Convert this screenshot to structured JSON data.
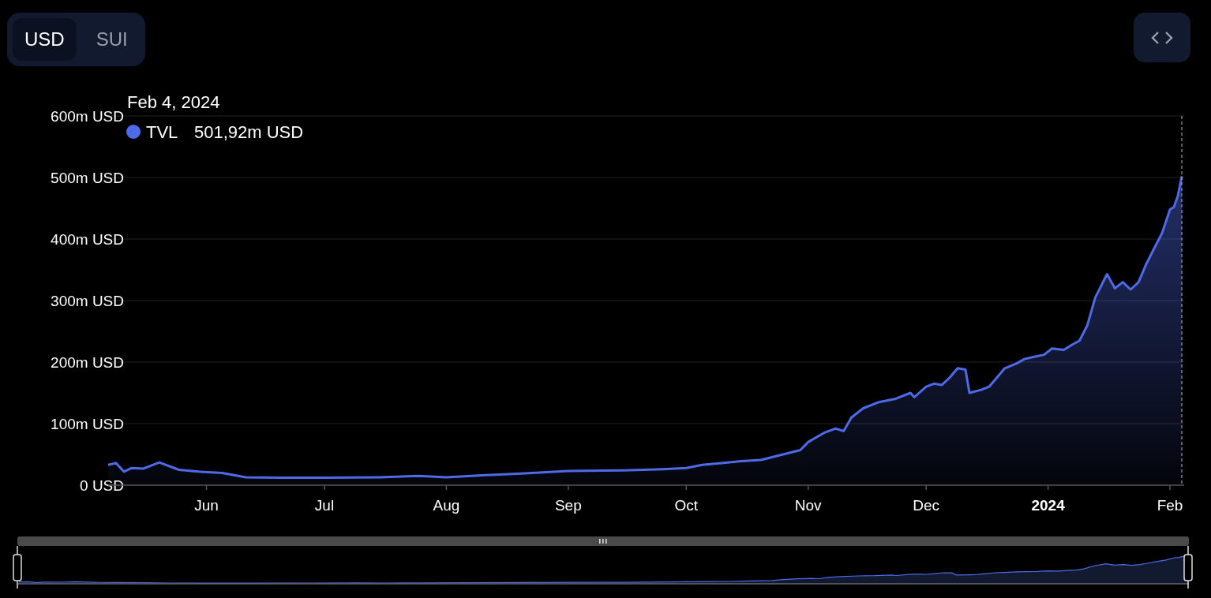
{
  "currency_toggle": [
    {
      "label": "USD",
      "selected": true
    },
    {
      "label": "SUI",
      "selected": false
    }
  ],
  "chart": {
    "tooltip": {
      "date": "Feb 4, 2024",
      "value": "501,92m USD"
    },
    "chart_data": {
      "type": "area",
      "grid": true,
      "xlim": [
        "2023-05-07",
        "2024-02-04"
      ],
      "ylim": [
        0,
        600
      ],
      "yticks": [
        {
          "value": 0,
          "label": "0 USD"
        },
        {
          "value": 100,
          "label": "100m USD"
        },
        {
          "value": 200,
          "label": "200m USD"
        },
        {
          "value": 300,
          "label": "300m USD"
        },
        {
          "value": 400,
          "label": "400m USD"
        },
        {
          "value": 500,
          "label": "500m USD"
        },
        {
          "value": 600,
          "label": "600m USD"
        }
      ],
      "xticks": [
        {
          "value": "2023-06-01",
          "label": "Jun"
        },
        {
          "value": "2023-07-01",
          "label": "Jul"
        },
        {
          "value": "2023-08-01",
          "label": "Aug"
        },
        {
          "value": "2023-09-01",
          "label": "Sep"
        },
        {
          "value": "2023-10-01",
          "label": "Oct"
        },
        {
          "value": "2023-11-01",
          "label": "Nov"
        },
        {
          "value": "2023-12-01",
          "label": "Dec"
        },
        {
          "value": "2024-01-01",
          "label": "2024"
        },
        {
          "value": "2024-02-01",
          "label": "Feb"
        }
      ],
      "x": [
        "2023-05-07",
        "2023-05-09",
        "2023-05-11",
        "2023-05-13",
        "2023-05-16",
        "2023-05-20",
        "2023-05-25",
        "2023-05-30",
        "2023-06-05",
        "2023-06-11",
        "2023-06-20",
        "2023-07-01",
        "2023-07-15",
        "2023-07-25",
        "2023-08-01",
        "2023-08-10",
        "2023-08-20",
        "2023-09-01",
        "2023-09-15",
        "2023-09-25",
        "2023-10-01",
        "2023-10-05",
        "2023-10-10",
        "2023-10-15",
        "2023-10-20",
        "2023-10-25",
        "2023-10-30",
        "2023-11-01",
        "2023-11-05",
        "2023-11-08",
        "2023-11-10",
        "2023-11-12",
        "2023-11-15",
        "2023-11-19",
        "2023-11-23",
        "2023-11-27",
        "2023-11-28",
        "2023-12-01",
        "2023-12-03",
        "2023-12-05",
        "2023-12-07",
        "2023-12-09",
        "2023-12-11",
        "2023-12-12",
        "2023-12-15",
        "2023-12-17",
        "2023-12-19",
        "2023-12-21",
        "2023-12-24",
        "2023-12-26",
        "2023-12-28",
        "2023-12-31",
        "2024-01-02",
        "2024-01-05",
        "2024-01-07",
        "2024-01-09",
        "2024-01-11",
        "2024-01-13",
        "2024-01-16",
        "2024-01-18",
        "2024-01-20",
        "2024-01-22",
        "2024-01-24",
        "2024-01-26",
        "2024-01-28",
        "2024-01-30",
        "2024-02-01",
        "2024-02-02",
        "2024-02-03",
        "2024-02-04"
      ],
      "series": [
        {
          "name": "TVL",
          "color": "#4f6ae8",
          "values": [
            33,
            36,
            22,
            28,
            27,
            37,
            25,
            22,
            20,
            13,
            12,
            12,
            13,
            15,
            13,
            16,
            19,
            23,
            24,
            26,
            28,
            33,
            36,
            39,
            41,
            49,
            57,
            70,
            85,
            92,
            88,
            110,
            125,
            135,
            140,
            150,
            143,
            160,
            165,
            163,
            175,
            190,
            188,
            150,
            155,
            160,
            175,
            190,
            198,
            205,
            208,
            212,
            222,
            220,
            228,
            235,
            260,
            305,
            343,
            320,
            330,
            318,
            330,
            360,
            385,
            410,
            448,
            452,
            470,
            502
          ]
        }
      ]
    }
  }
}
